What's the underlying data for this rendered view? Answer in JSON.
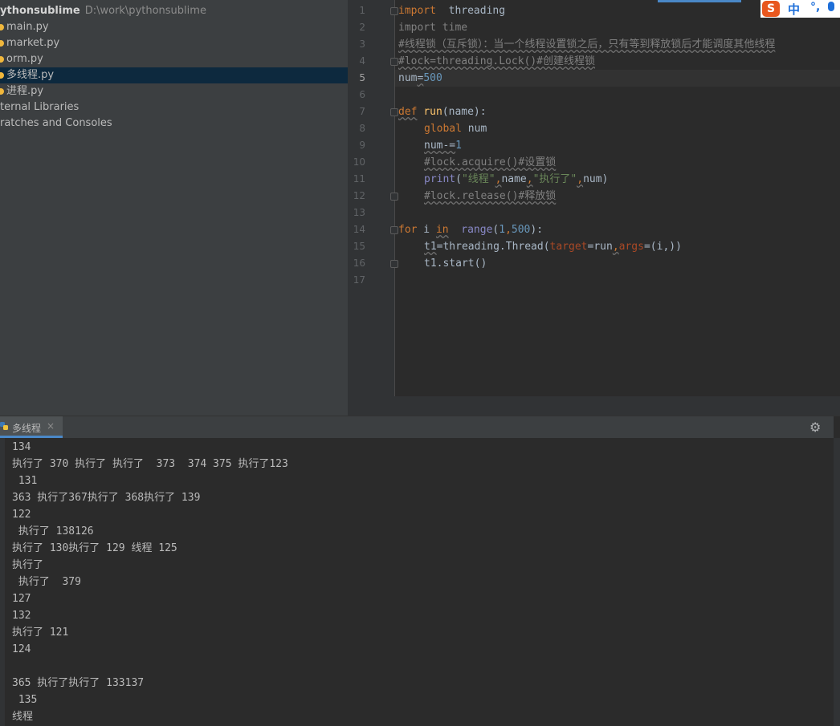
{
  "project": {
    "root_name": "ythonsublime",
    "root_path": "D:\\work\\pythonsublime",
    "items": [
      {
        "label": "main.py",
        "icon": "python-file-icon"
      },
      {
        "label": "market.py",
        "icon": "python-file-icon"
      },
      {
        "label": "orm.py",
        "icon": "python-file-icon"
      },
      {
        "label": "多线程.py",
        "icon": "python-file-icon",
        "selected": true
      },
      {
        "label": "进程.py",
        "icon": "python-file-icon"
      }
    ],
    "external_libraries": "ternal Libraries",
    "scratches": "ratches and Consoles"
  },
  "editor": {
    "line_numbers": [
      "1",
      "2",
      "3",
      "4",
      "5",
      "6",
      "7",
      "8",
      "9",
      "10",
      "11",
      "12",
      "13",
      "14",
      "15",
      "16",
      "17"
    ],
    "current_line": "5",
    "code": {
      "l1": {
        "kw": "import",
        "rest": "  threading"
      },
      "l2": {
        "text": "import time"
      },
      "l3": {
        "text": "#线程锁（互斥锁）：当一个线程设置锁之后，只有等到释放锁后才能调度其他线程"
      },
      "l4": {
        "text": "#lock=threading.Lock()#创建线程锁"
      },
      "l5": {
        "name": "num",
        "eq": "=",
        "num": "500"
      },
      "l7": {
        "kw": "def",
        "fn": "run",
        "rest": "(name):"
      },
      "l8": {
        "kw": "global",
        "rest": " num"
      },
      "l9": {
        "name": "num-=",
        "num": "1"
      },
      "l10": {
        "text": "#lock.acquire()#设置锁"
      },
      "l11": {
        "fn": "print",
        "open": "(",
        "s1": "\"线程\"",
        "c1": ",",
        "arg": "name",
        "c2": ",",
        "s2": "\"执行了\"",
        "c3": ",",
        "tail": "num)"
      },
      "l12": {
        "text": "#lock.release()#释放锁"
      },
      "l14": {
        "kw1": "for",
        "var": " i ",
        "kw2": "in",
        "builtin": "range",
        "open": "(",
        "n1": "1",
        "c": ",",
        "n2": "500",
        "close": "):"
      },
      "l15": {
        "name": "t1",
        "mid": "=threading.Thread(",
        "p1": "target",
        "eq1": "=run",
        "c": ",",
        "p2": "args",
        "tail": "=(i,))"
      },
      "l16": {
        "text": "t1.start()"
      }
    }
  },
  "ime": {
    "logo": "S",
    "lang": "中",
    "punct": "°,"
  },
  "run_panel": {
    "tab_label": "多线程",
    "close": "×",
    "settings_icon": "gear-icon",
    "output": [
      "134",
      "执行了 370 执行了 执行了  373  374 375 执行了123",
      " 131",
      "363 执行了367执行了 368执行了 139",
      "122",
      " 执行了 138126",
      "执行了 130执行了 129 线程 125",
      "执行了",
      " 执行了  379",
      "127",
      "132",
      "执行了 121",
      "124",
      "",
      "365 执行了执行了 133137",
      " 135",
      "线程"
    ]
  },
  "colors": {
    "keyword": "#cc7832",
    "function": "#ffc66d",
    "number": "#6897bb",
    "string": "#6a8759",
    "comment": "#808080",
    "builtin": "#8888c6",
    "param": "#aa4926",
    "selection": "#0d293e",
    "accent": "#4a88c7"
  }
}
